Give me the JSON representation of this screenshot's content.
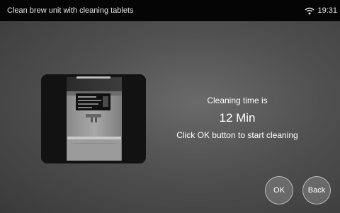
{
  "status_bar": {
    "title": "Clean brew unit with cleaning tablets",
    "time": "19:31",
    "wifi_icon": "wifi-icon"
  },
  "main": {
    "illustration": "coffee-machine-illustration",
    "line1": "Cleaning time is",
    "time_value": "12 Min",
    "line2": "Click OK button to start cleaning"
  },
  "buttons": {
    "ok_label": "OK",
    "back_label": "Back"
  },
  "colors": {
    "status_bar_bg": "#050505",
    "background": "#505050",
    "text": "#ffffff"
  }
}
